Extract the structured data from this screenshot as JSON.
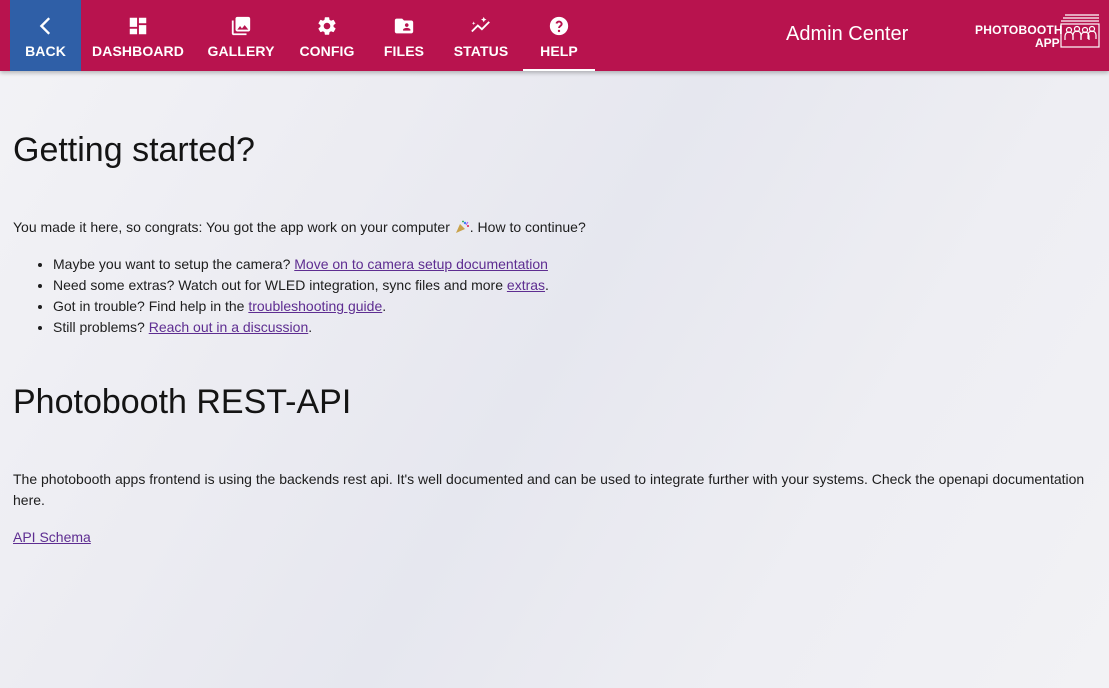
{
  "nav": {
    "items": [
      {
        "label": "BACK",
        "icon": "chevron-left-icon"
      },
      {
        "label": "DASHBOARD",
        "icon": "dashboard-icon"
      },
      {
        "label": "GALLERY",
        "icon": "photo-library-icon"
      },
      {
        "label": "CONFIG",
        "icon": "gear-icon"
      },
      {
        "label": "FILES",
        "icon": "folder-user-icon"
      },
      {
        "label": "STATUS",
        "icon": "insights-icon"
      },
      {
        "label": "HELP",
        "icon": "help-icon"
      }
    ],
    "active": "HELP",
    "title": "Admin Center",
    "logo": {
      "line1": "PHOTOBOOTH",
      "line2": "APP"
    }
  },
  "colors": {
    "header": "#b8134e",
    "back_button": "#2f5fa7",
    "link": "#5e2d91"
  },
  "content": {
    "getting_started": {
      "heading": "Getting started?",
      "intro_before": "You made it here, so congrats: You got the app work on your computer",
      "intro_after": ". How to continue?",
      "items": [
        {
          "text": "Maybe you want to setup the camera? ",
          "link": "Move on to camera setup documentation",
          "after": ""
        },
        {
          "text": "Need some extras? Watch out for WLED integration, sync files and more ",
          "link": "extras",
          "after": "."
        },
        {
          "text": "Got in trouble? Find help in the ",
          "link": "troubleshooting guide",
          "after": "."
        },
        {
          "text": "Still problems? ",
          "link": "Reach out in a discussion",
          "after": "."
        }
      ]
    },
    "rest_api": {
      "heading": "Photobooth REST-API",
      "text": "The photobooth apps frontend is using the backends rest api. It's well documented and can be used to integrate further with your systems. Check the openapi documentation here.",
      "link": "API Schema"
    }
  }
}
